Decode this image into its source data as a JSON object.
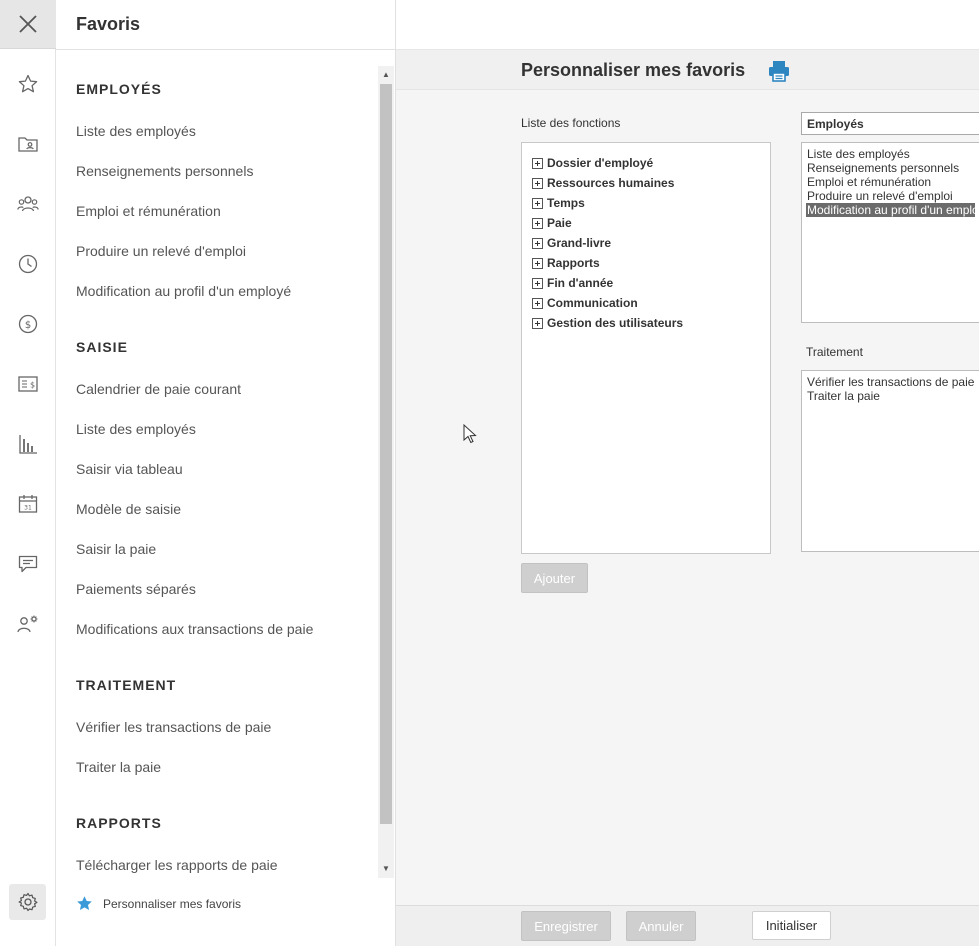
{
  "rail": {
    "icons": [
      "close-icon",
      "star-icon",
      "folder-user-icon",
      "group-icon",
      "clock-icon",
      "dollar-icon",
      "payslip-icon",
      "bar-chart-icon",
      "calendar-icon",
      "chat-icon",
      "user-settings-icon",
      "gear-icon"
    ],
    "calendar_day": "31"
  },
  "favorites": {
    "title": "Favoris",
    "sections": [
      {
        "title": "EMPLOYÉS",
        "items": [
          "Liste des employés",
          "Renseignements personnels",
          "Emploi et rémunération",
          "Produire un relevé d'emploi",
          "Modification au profil d'un employé"
        ]
      },
      {
        "title": "SAISIE",
        "items": [
          "Calendrier de paie courant",
          "Liste des employés",
          "Saisir via tableau",
          "Modèle de saisie",
          "Saisir la paie",
          "Paiements séparés",
          "Modifications aux transactions de paie"
        ]
      },
      {
        "title": "TRAITEMENT",
        "items": [
          "Vérifier les transactions de paie",
          "Traiter la paie"
        ]
      },
      {
        "title": "RAPPORTS",
        "items": [
          "Télécharger les rapports de paie"
        ]
      }
    ],
    "footer_label": "Personnaliser mes favoris"
  },
  "main": {
    "title": "Personnaliser mes favoris",
    "functions_label": "Liste des fonctions",
    "tree": [
      "Dossier d'employé",
      "Ressources humaines",
      "Temps",
      "Paie",
      "Grand-livre",
      "Rapports",
      "Fin d'année",
      "Communication",
      "Gestion des utilisateurs"
    ],
    "add_button": "Ajouter",
    "category_select": "Employés",
    "selected_list": [
      "Liste des employés",
      "Renseignements personnels",
      "Emploi et rémunération",
      "Produire un relevé d'emploi",
      "Modification au profil d'un employé"
    ],
    "selected_index": 4,
    "treatment_label": "Traitement",
    "treatment_list": [
      "Vérifier les transactions de paie",
      "Traiter la paie"
    ],
    "save_button": "Enregistrer",
    "cancel_button": "Annuler",
    "reset_button": "Initialiser"
  },
  "colors": {
    "accent_star": "#3d9ad8",
    "print_icon": "#2e86c1",
    "selected_bg": "#6b6b6b"
  }
}
